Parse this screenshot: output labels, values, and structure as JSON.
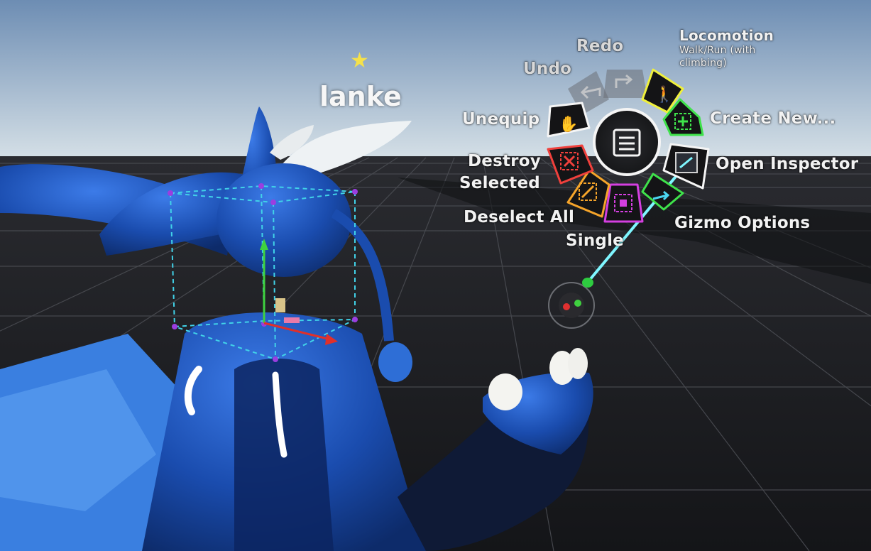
{
  "user": {
    "name": "lanke",
    "badge_icon": "star-icon"
  },
  "radial_menu": {
    "center_icon": "context-menu-icon",
    "items": [
      {
        "id": "redo",
        "label": "Redo",
        "icon": "redo-arrow-icon",
        "color": "#6b6f76",
        "enabled": false
      },
      {
        "id": "undo",
        "label": "Undo",
        "icon": "undo-arrow-icon",
        "color": "#6b6f76",
        "enabled": false
      },
      {
        "id": "locomotion",
        "label": "Locomotion",
        "sublabel": "Walk/Run (with climbing)",
        "icon": "walk-icon",
        "color": "#f0f03c",
        "enabled": true
      },
      {
        "id": "create-new",
        "label": "Create New...",
        "icon": "add-square-icon",
        "color": "#3fe24b",
        "enabled": true
      },
      {
        "id": "open-inspector",
        "label": "Open Inspector",
        "icon": "inspector-icon",
        "color": "#f5f5f5",
        "enabled": true
      },
      {
        "id": "gizmo-options",
        "label": "Gizmo Options",
        "icon": "gizmo-arrow-icon",
        "color": "#3fe24b",
        "enabled": true
      },
      {
        "id": "single",
        "label": "Single",
        "icon": "select-single-icon",
        "color": "#d43fe0",
        "enabled": true
      },
      {
        "id": "deselect-all",
        "label": "Deselect All",
        "icon": "deselect-icon",
        "color": "#f5a42a",
        "enabled": true
      },
      {
        "id": "destroy-selected",
        "label": "Destroy Selected",
        "label_line1": "Destroy",
        "label_line2": "Selected",
        "icon": "destroy-icon",
        "color": "#f0403c",
        "enabled": true
      },
      {
        "id": "unequip",
        "label": "Unequip",
        "icon": "hand-icon",
        "color": "#f5f5f5",
        "enabled": true
      }
    ]
  },
  "colors": {
    "sky_top": "#6f8fb4",
    "sky_horizon": "#d2dde4",
    "floor": "#1c1d21",
    "avatar_blue": "#1b4fb0",
    "laser": "#7ff6ff",
    "selection_box": "#41d2e8"
  }
}
